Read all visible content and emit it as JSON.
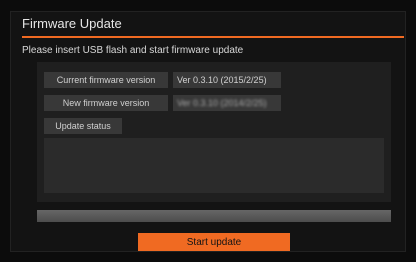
{
  "dialog": {
    "title": "Firmware Update",
    "instruction": "Please insert USB flash and start firmware update"
  },
  "info": {
    "current_label": "Current firmware version",
    "current_value": "Ver 0.3.10 (2015/2/25)",
    "new_label": "New firmware version",
    "new_value": "Ver 0.3.10 (2014/2/25)",
    "status_label": "Update status",
    "status_value": ""
  },
  "progress": {
    "percent": 0
  },
  "actions": {
    "start_label": "Start update"
  },
  "colors": {
    "accent": "#f06a22",
    "background": "#0c0c0c",
    "panel": "#1f1f1f",
    "box": "#383838"
  }
}
